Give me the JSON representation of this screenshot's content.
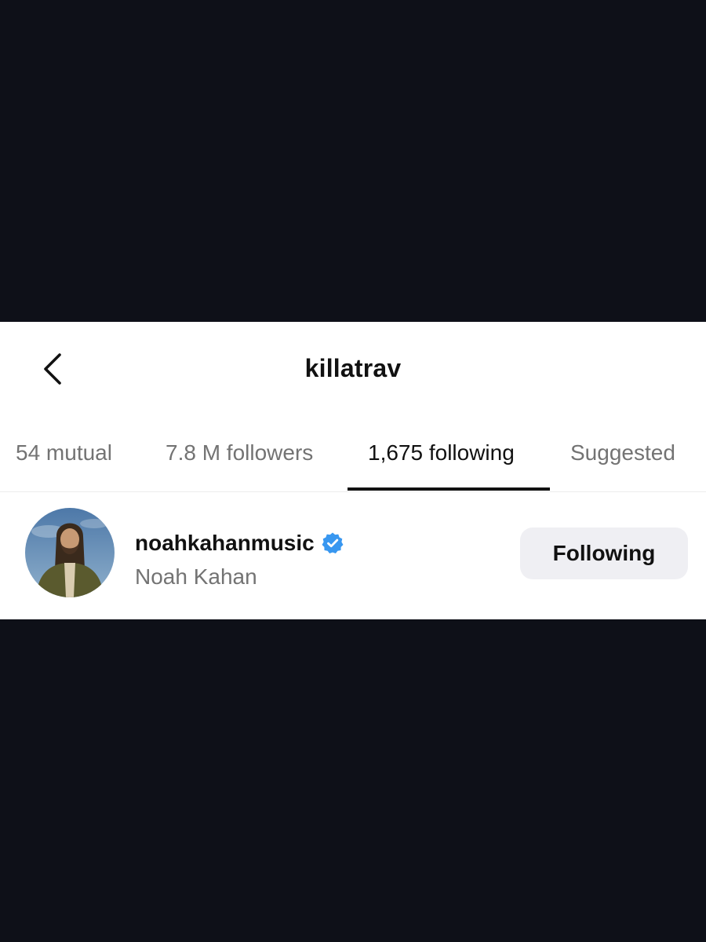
{
  "colors": {
    "background_dark": "#0e1018",
    "panel": "#ffffff",
    "text_primary": "#111111",
    "text_secondary": "#737373",
    "button_bg": "#efeff3",
    "verified_blue": "#3897f0"
  },
  "header": {
    "title": "killatrav",
    "back_icon": "chevron-left-icon"
  },
  "tabs": [
    {
      "label": "54 mutual",
      "active": false
    },
    {
      "label": "7.8 M followers",
      "active": false
    },
    {
      "label": "1,675 following",
      "active": true
    },
    {
      "label": "Suggested",
      "active": false
    }
  ],
  "list": {
    "items": [
      {
        "username": "noahkahanmusic",
        "full_name": "Noah Kahan",
        "verified": true,
        "verified_icon": "verified-badge-icon",
        "button_label": "Following"
      }
    ]
  }
}
